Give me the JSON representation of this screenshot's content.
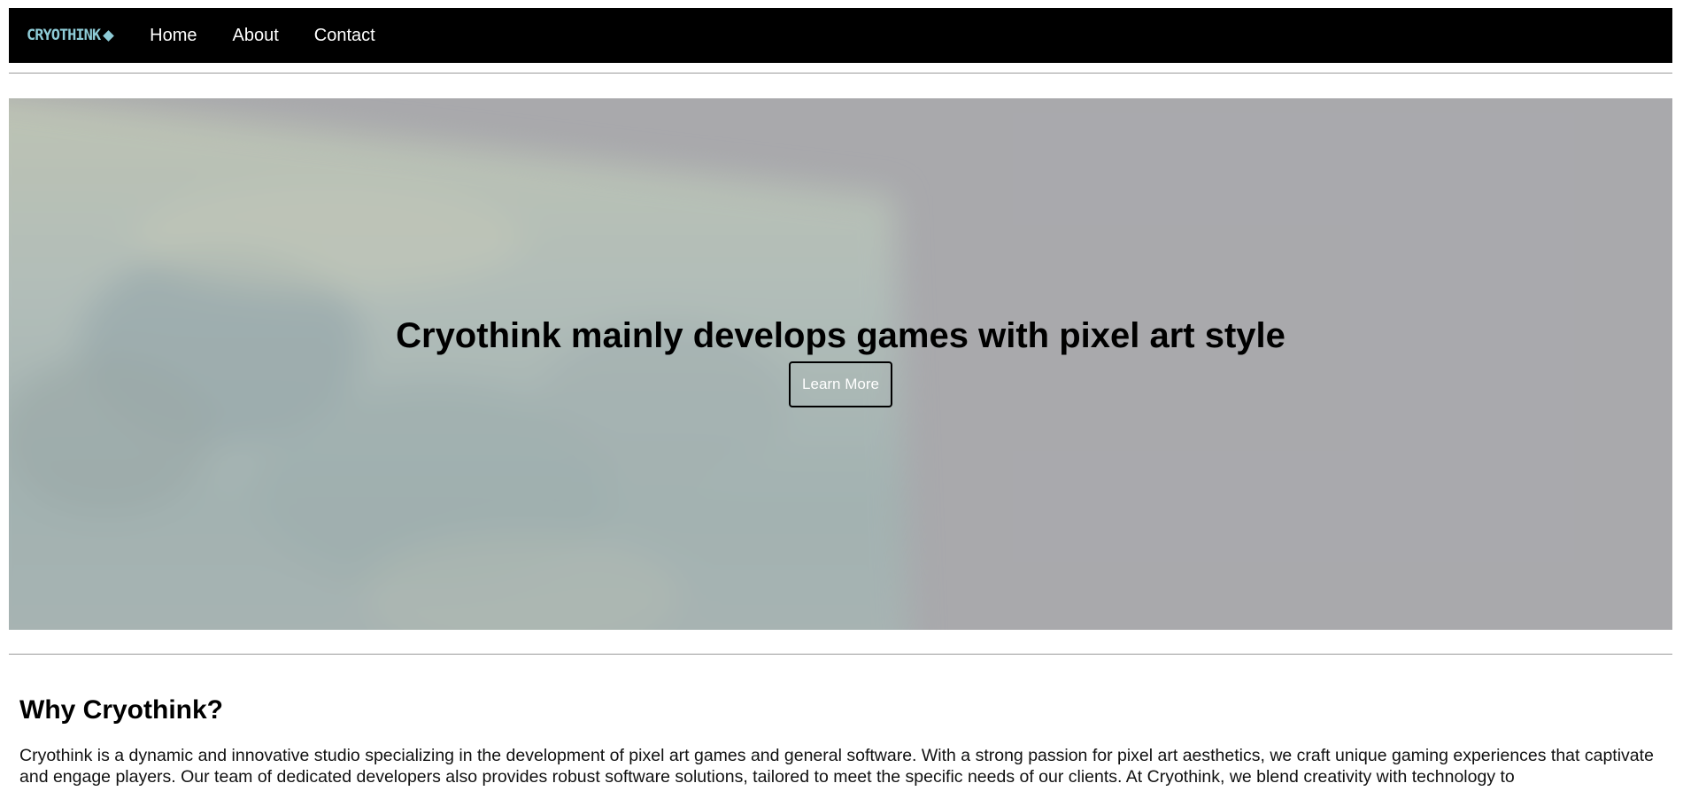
{
  "brand": {
    "logo_text": "CRYOTHINK",
    "logo_icon": "diamond-icon",
    "logo_color": "#8ecbd6"
  },
  "nav": {
    "items": [
      {
        "label": "Home"
      },
      {
        "label": "About"
      },
      {
        "label": "Contact"
      }
    ]
  },
  "hero": {
    "title": "Cryothink mainly develops games with pixel art style",
    "button_label": "Learn More"
  },
  "why": {
    "heading": "Why Cryothink?",
    "body": "Cryothink is a dynamic and innovative studio specializing in the development of pixel art games and general software. With a strong passion for pixel art aesthetics, we craft unique gaming experiences that captivate and engage players. Our team of dedicated developers also provides robust software solutions, tailored to meet the specific needs of our clients. At Cryothink, we blend creativity with technology to"
  },
  "colors": {
    "navbar_bg": "#000000",
    "hero_gray": "#a9a9ad",
    "divider": "#9a9a9a"
  }
}
